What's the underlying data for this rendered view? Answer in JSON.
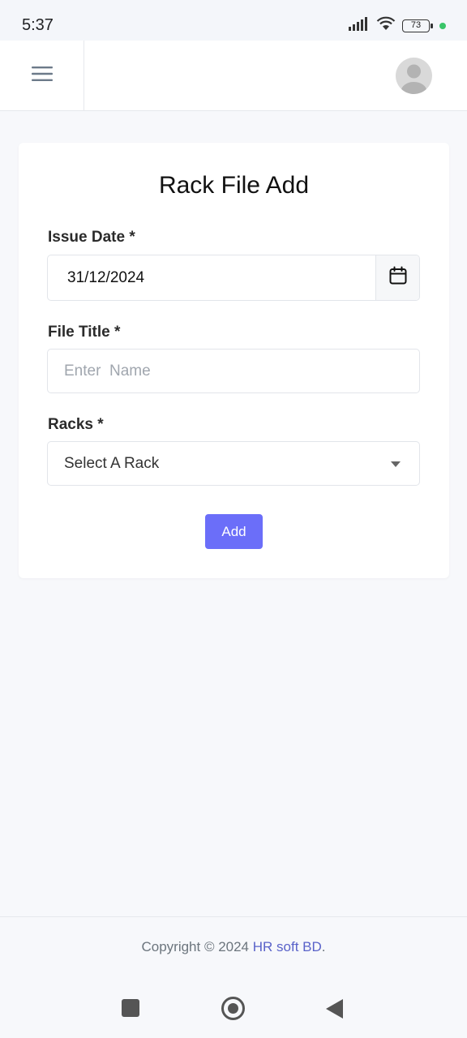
{
  "status_bar": {
    "time": "5:37",
    "battery": "73",
    "icons": [
      "signal-icon",
      "wifi-icon",
      "battery-icon",
      "green-dot-icon"
    ]
  },
  "header": {
    "menu_icon": "hamburger-menu-icon",
    "avatar_icon": "user-avatar-icon"
  },
  "form": {
    "title": "Rack File Add",
    "issue_date_label": "Issue Date *",
    "issue_date_value": "31/12/2024",
    "calendar_icon": "calendar-icon",
    "file_title_label": "File Title *",
    "file_title_placeholder": "Enter  Name",
    "file_title_value": "",
    "racks_label": "Racks *",
    "racks_selected": "Select A Rack",
    "add_button": "Add"
  },
  "footer": {
    "copyright": "Copyright © 2024 ",
    "brand": "HR soft BD",
    "period": "."
  },
  "colors": {
    "primary_button": "#6b6ef9",
    "brand_link": "#5a63c9",
    "page_background": "#f7f8fb"
  }
}
